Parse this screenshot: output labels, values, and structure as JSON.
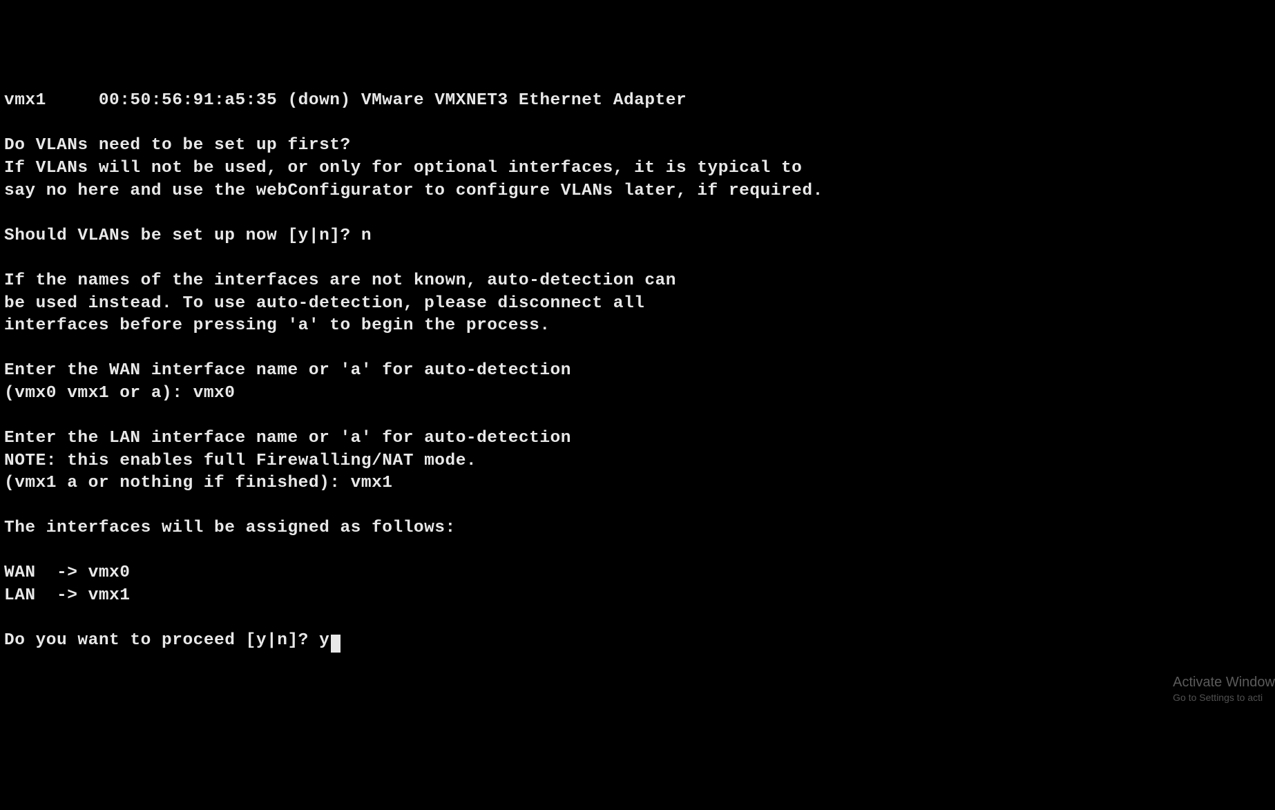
{
  "terminal": {
    "iface_line": "vmx1     00:50:56:91:a5:35 (down) VMware VMXNET3 Ethernet Adapter",
    "blank1": "",
    "vlan_q1": "Do VLANs need to be set up first?",
    "vlan_q2": "If VLANs will not be used, or only for optional interfaces, it is typical to",
    "vlan_q3": "say no here and use the webConfigurator to configure VLANs later, if required.",
    "blank2": "",
    "vlan_prompt": "Should VLANs be set up now [y|n]? n",
    "blank3": "",
    "auto1": "If the names of the interfaces are not known, auto-detection can",
    "auto2": "be used instead. To use auto-detection, please disconnect all",
    "auto3": "interfaces before pressing 'a' to begin the process.",
    "blank4": "",
    "wan1": "Enter the WAN interface name or 'a' for auto-detection",
    "wan2": "(vmx0 vmx1 or a): vmx0",
    "blank5": "",
    "lan1": "Enter the LAN interface name or 'a' for auto-detection",
    "lan2": "NOTE: this enables full Firewalling/NAT mode.",
    "lan3": "(vmx1 a or nothing if finished): vmx1",
    "blank6": "",
    "assign_hdr": "The interfaces will be assigned as follows:",
    "blank7": "",
    "assign_wan": "WAN  -> vmx0",
    "assign_lan": "LAN  -> vmx1",
    "blank8": "",
    "proceed": "Do you want to proceed [y|n]? y"
  },
  "watermark": {
    "title": "Activate Window",
    "sub": "Go to Settings to acti"
  }
}
